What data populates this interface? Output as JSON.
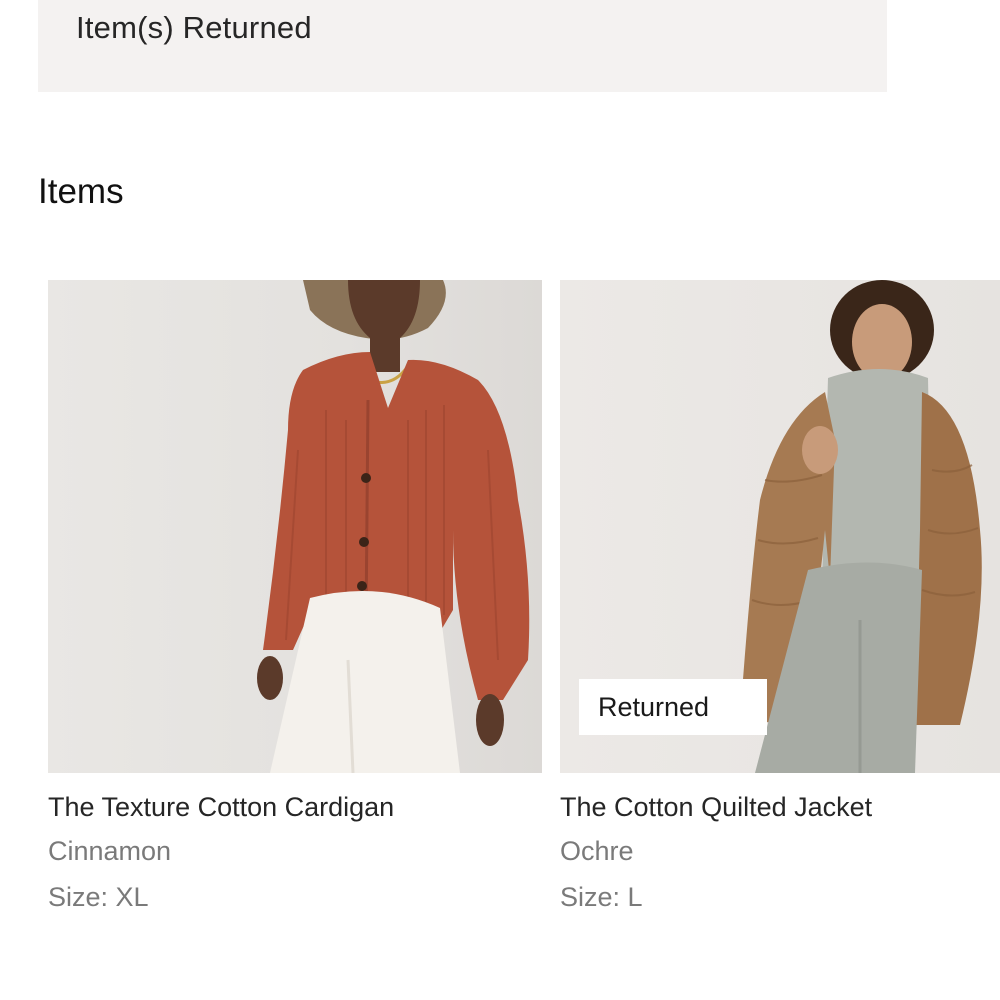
{
  "status_banner": {
    "text": "Item(s) Returned"
  },
  "items_section": {
    "title": "Items",
    "items": [
      {
        "name": "The Texture Cotton Cardigan",
        "color": "Cinnamon",
        "size": "Size: XL",
        "badge": "",
        "image": "product-photo-cardigan"
      },
      {
        "name": "The Cotton Quilted Jacket",
        "color": "Ochre",
        "size": "Size: L",
        "badge": "Returned",
        "image": "product-photo-quilted-jacket"
      }
    ]
  },
  "colors": {
    "banner_bg": "#f4f2f1",
    "secondary_text": "#7a7a7a",
    "cardigan": "#b5533a",
    "jacket": "#a67a52"
  }
}
